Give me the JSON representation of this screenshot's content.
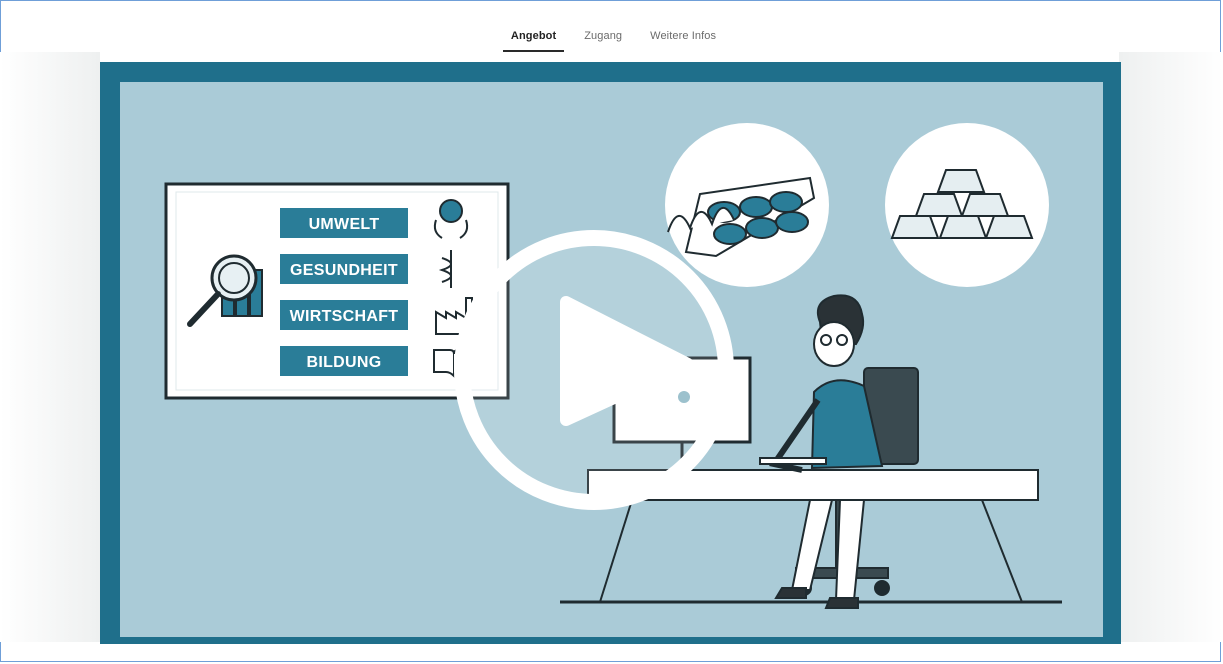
{
  "tabs": [
    {
      "label": "Angebot",
      "active": true
    },
    {
      "label": "Zugang",
      "active": false
    },
    {
      "label": "Weitere Infos",
      "active": false
    }
  ],
  "video": {
    "topics": [
      "UMWELT",
      "GESUNDHEIT",
      "WIRTSCHAFT",
      "BILDUNG"
    ],
    "play_icon": "play-icon",
    "colors": {
      "frame": "#1f6f8b",
      "scene": "#aacbd7",
      "label_bg": "#2a7d98",
      "ink": "#1f2b30"
    }
  }
}
